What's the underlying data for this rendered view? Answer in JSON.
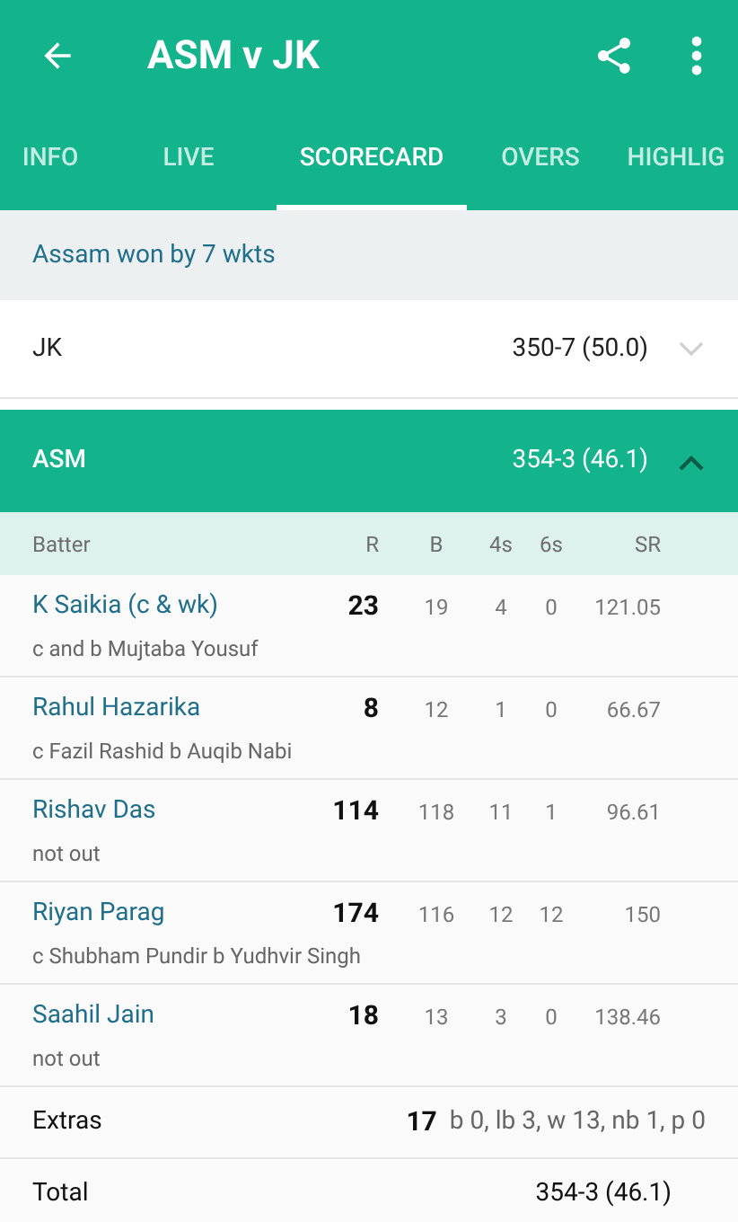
{
  "app_bar": {
    "title": "ASM v JK"
  },
  "tabs": [
    {
      "label": "INFO",
      "selected": false
    },
    {
      "label": "LIVE",
      "selected": false
    },
    {
      "label": "SCORECARD",
      "selected": true
    },
    {
      "label": "OVERS",
      "selected": false
    },
    {
      "label": "HIGHLIG",
      "selected": false
    }
  ],
  "result": "Assam won by 7 wkts",
  "innings": [
    {
      "team": "JK",
      "score": "350-7 (50.0)",
      "expanded": false
    },
    {
      "team": "ASM",
      "score": "354-3 (46.1)",
      "expanded": true
    }
  ],
  "batting": {
    "columns": [
      "Batter",
      "R",
      "B",
      "4s",
      "6s",
      "SR"
    ],
    "rows": [
      {
        "name": "K Saikia (c & wk)",
        "dismissal": "c and b Mujtaba Yousuf",
        "r": "23",
        "b": "19",
        "fours": "4",
        "sixes": "0",
        "sr": "121.05"
      },
      {
        "name": "Rahul Hazarika",
        "dismissal": "c Fazil Rashid b Auqib Nabi",
        "r": "8",
        "b": "12",
        "fours": "1",
        "sixes": "0",
        "sr": "66.67"
      },
      {
        "name": "Rishav Das",
        "dismissal": "not out",
        "r": "114",
        "b": "118",
        "fours": "11",
        "sixes": "1",
        "sr": "96.61"
      },
      {
        "name": "Riyan Parag",
        "dismissal": "c Shubham Pundir b Yudhvir Singh",
        "r": "174",
        "b": "116",
        "fours": "12",
        "sixes": "12",
        "sr": "150"
      },
      {
        "name": "Saahil Jain",
        "dismissal": "not out",
        "r": "18",
        "b": "13",
        "fours": "3",
        "sixes": "0",
        "sr": "138.46"
      }
    ],
    "extras": {
      "label": "Extras",
      "value": "17",
      "detail": "b 0, lb 3, w 13, nb 1, p 0"
    },
    "total": {
      "label": "Total",
      "value": "354-3 (46.1)"
    }
  }
}
